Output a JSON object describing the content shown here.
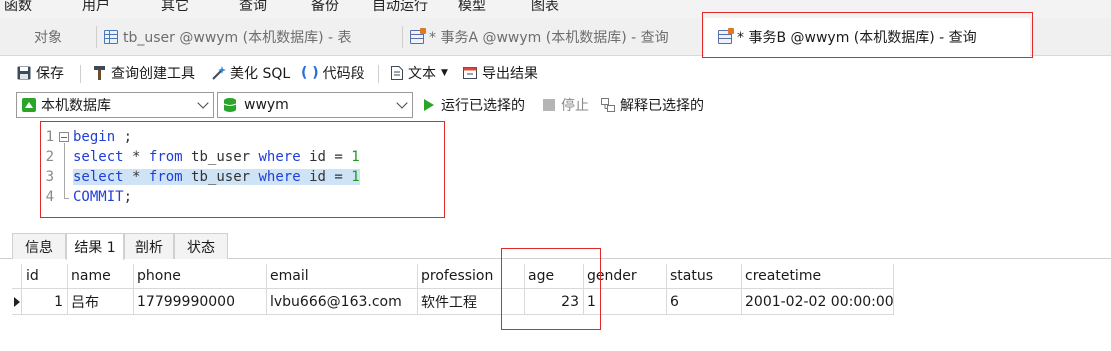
{
  "menu": {
    "items": [
      "函数",
      "用户",
      "其它",
      "查询",
      "备份",
      "自动运行",
      "模型",
      "图表"
    ]
  },
  "tabs": {
    "items": [
      {
        "label": "对象",
        "icon": "none"
      },
      {
        "label": "tb_user @wwym (本机数据库) - 表",
        "icon": "table-icon"
      },
      {
        "label": "* 事务A @wwym (本机数据库) - 查询",
        "icon": "query-icon"
      },
      {
        "label": "* 事务B @wwym (本机数据库) - 查询",
        "icon": "query-icon"
      }
    ]
  },
  "toolbar": {
    "save": "保存",
    "query_builder": "查询创建工具",
    "beautify": "美化 SQL",
    "code_snippet": "代码段",
    "text": "文本",
    "export": "导出结果"
  },
  "connection": {
    "server": "本机数据库",
    "database": "wwym",
    "run_selected": "运行已选择的",
    "stop": "停止",
    "explain_selected": "解释已选择的"
  },
  "editor": {
    "lines": [
      {
        "num": "1",
        "text": "begin ;"
      },
      {
        "num": "2",
        "text": "select * from tb_user where id = 1"
      },
      {
        "num": "3",
        "text": "select * from tb_user where id = 1"
      },
      {
        "num": "4",
        "text": "COMMIT;"
      }
    ],
    "selected_line": 3
  },
  "result_tabs": [
    "信息",
    "结果 1",
    "剖析",
    "状态"
  ],
  "result_tabs_active": "结果 1",
  "grid": {
    "columns": [
      "id",
      "name",
      "phone",
      "email",
      "profession",
      "age",
      "gender",
      "status",
      "createtime"
    ],
    "rows": [
      [
        "1",
        "吕布",
        "17799990000",
        "lvbu666@163.com",
        "软件工程",
        "23",
        "1",
        "6",
        "2001-02-02 00:00:00"
      ]
    ]
  },
  "colors": {
    "keyword": "#1f3fd6",
    "number": "#1a9c1a",
    "selection": "#cfe3f7",
    "annotation": "#e02a2a",
    "run_icon": "#2aa52a"
  }
}
